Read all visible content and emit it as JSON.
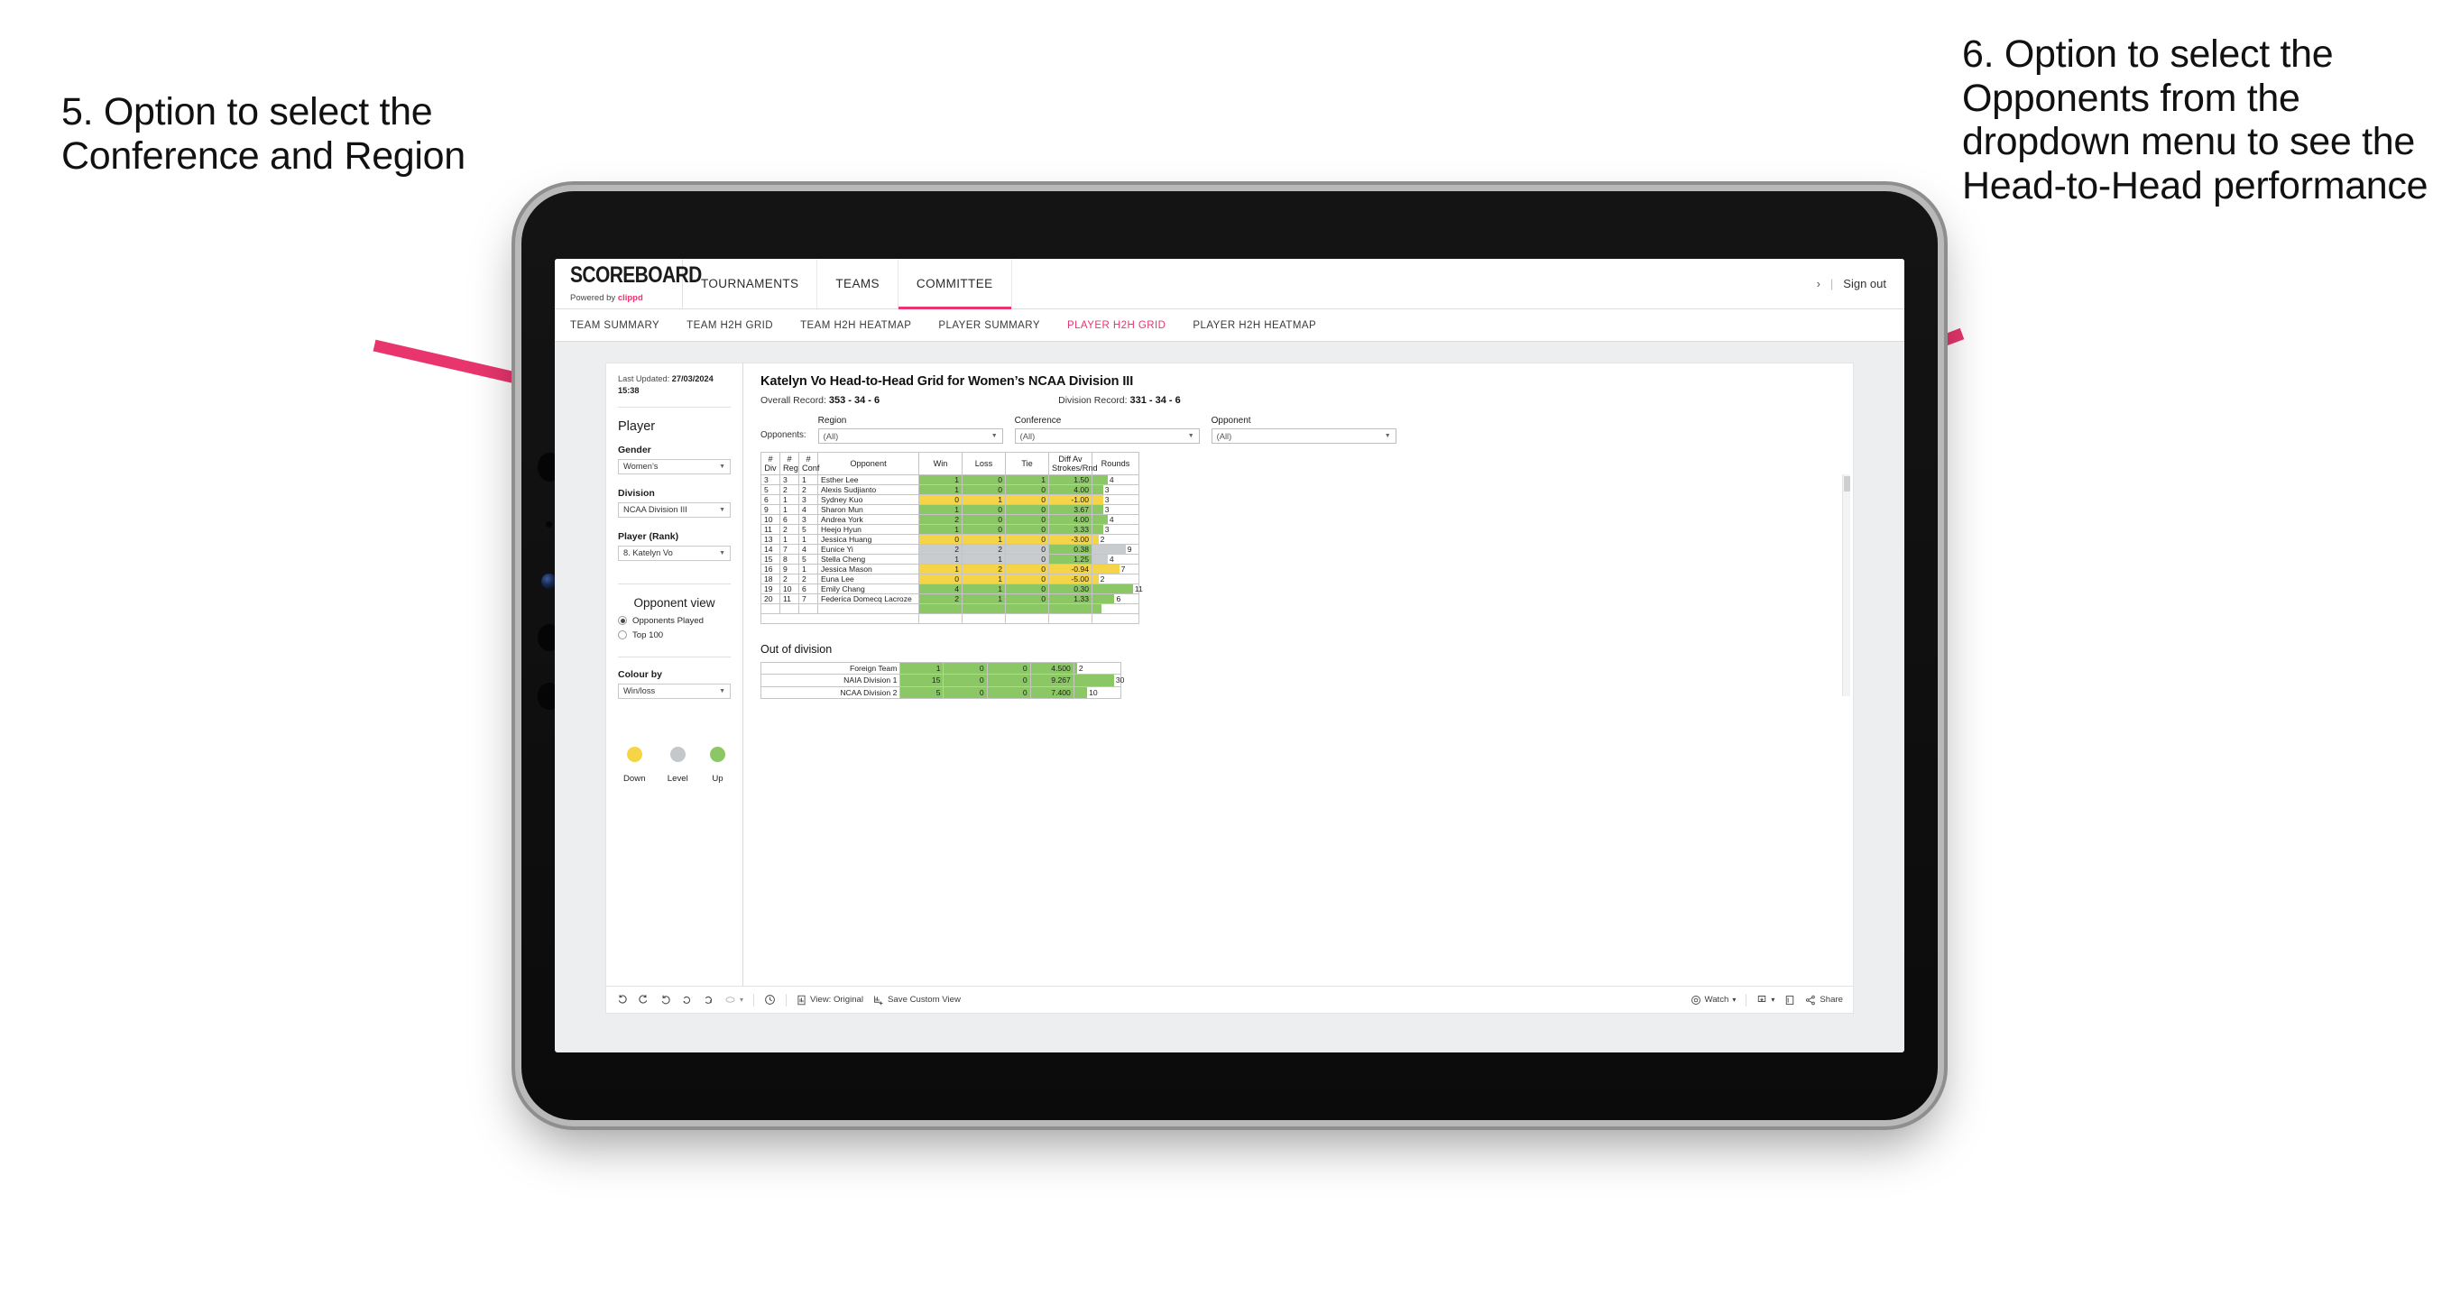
{
  "annotations": {
    "left": "5. Option to select the Conference and Region",
    "right": "6. Option to select the Opponents from the dropdown menu to see the Head-to-Head performance",
    "arrow_color": "#e8356d"
  },
  "header": {
    "logo_word": "SCOREBOARD",
    "logo_powered_prefix": "Powered by ",
    "logo_brand": "clippd",
    "nav": [
      {
        "label": "TOURNAMENTS",
        "active": false
      },
      {
        "label": "TEAMS",
        "active": false
      },
      {
        "label": "COMMITTEE",
        "active": true
      }
    ],
    "chevron": "›",
    "separator": "|",
    "sign_out": "Sign out"
  },
  "subnav": [
    {
      "label": "TEAM SUMMARY",
      "active": false
    },
    {
      "label": "TEAM H2H GRID",
      "active": false
    },
    {
      "label": "TEAM H2H HEATMAP",
      "active": false
    },
    {
      "label": "PLAYER SUMMARY",
      "active": false
    },
    {
      "label": "PLAYER H2H GRID",
      "active": true
    },
    {
      "label": "PLAYER H2H HEATMAP",
      "active": false
    }
  ],
  "sidebar": {
    "last_updated_label": "Last Updated: ",
    "last_updated_value": "27/03/2024",
    "last_updated_time": "15:38",
    "player_heading": "Player",
    "gender_label": "Gender",
    "gender_value": "Women’s",
    "division_label": "Division",
    "division_value": "NCAA Division III",
    "player_rank_label": "Player (Rank)",
    "player_rank_value": "8. Katelyn Vo",
    "opponent_view_heading": "Opponent view",
    "opponent_view_options": [
      {
        "label": "Opponents Played",
        "selected": true
      },
      {
        "label": "Top 100",
        "selected": false
      }
    ],
    "colour_by_label": "Colour by",
    "colour_by_value": "Win/loss",
    "legend": [
      {
        "label": "Down",
        "color": "#f5d547"
      },
      {
        "label": "Level",
        "color": "#c4c8cc"
      },
      {
        "label": "Up",
        "color": "#8cc765"
      }
    ]
  },
  "main": {
    "title": "Katelyn Vo Head-to-Head Grid for Women’s NCAA Division III",
    "overall_record_label": "Overall Record: ",
    "overall_record_value": "353 - 34 - 6",
    "division_record_label": "Division Record: ",
    "division_record_value": "331 -  34 - 6",
    "opponents_label": "Opponents:",
    "filters": [
      {
        "caption": "Region",
        "value": "(All)"
      },
      {
        "caption": "Conference",
        "value": "(All)"
      },
      {
        "caption": "Opponent",
        "value": "(All)"
      }
    ]
  },
  "table": {
    "headers": {
      "div": [
        "#",
        "Div"
      ],
      "reg": [
        "#",
        "Reg"
      ],
      "conf": [
        "#",
        "Conf"
      ],
      "opponent": "Opponent",
      "win": "Win",
      "loss": "Loss",
      "tie": "Tie",
      "diff": [
        "Diff Av",
        "Strokes/Rnd"
      ],
      "rounds": "Rounds"
    },
    "rows": [
      {
        "div": "3",
        "reg": "3",
        "conf": "1",
        "opponent": "Esther Lee",
        "win": "1",
        "loss": "0",
        "tie": "1",
        "diff": "1.50",
        "rounds": "4",
        "color": "#8cc765",
        "bar_pct": 33
      },
      {
        "div": "5",
        "reg": "2",
        "conf": "2",
        "opponent": "Alexis Sudjianto",
        "win": "1",
        "loss": "0",
        "tie": "0",
        "diff": "4.00",
        "rounds": "3",
        "color": "#8cc765",
        "bar_pct": 23
      },
      {
        "div": "6",
        "reg": "1",
        "conf": "3",
        "opponent": "Sydney Kuo",
        "win": "0",
        "loss": "1",
        "tie": "0",
        "diff": "-1.00",
        "rounds": "3",
        "color": "#f5d547",
        "bar_pct": 23
      },
      {
        "div": "9",
        "reg": "1",
        "conf": "4",
        "opponent": "Sharon Mun",
        "win": "1",
        "loss": "0",
        "tie": "0",
        "diff": "3.67",
        "rounds": "3",
        "color": "#8cc765",
        "bar_pct": 23
      },
      {
        "div": "10",
        "reg": "6",
        "conf": "3",
        "opponent": "Andrea York",
        "win": "2",
        "loss": "0",
        "tie": "0",
        "diff": "4.00",
        "rounds": "4",
        "color": "#8cc765",
        "bar_pct": 33
      },
      {
        "div": "11",
        "reg": "2",
        "conf": "5",
        "opponent": "Heejo Hyun",
        "win": "1",
        "loss": "0",
        "tie": "0",
        "diff": "3.33",
        "rounds": "3",
        "color": "#8cc765",
        "bar_pct": 23
      },
      {
        "div": "13",
        "reg": "1",
        "conf": "1",
        "opponent": "Jessica Huang",
        "win": "0",
        "loss": "1",
        "tie": "0",
        "diff": "-3.00",
        "rounds": "2",
        "color": "#f5d547",
        "bar_pct": 13
      },
      {
        "div": "14",
        "reg": "7",
        "conf": "4",
        "opponent": "Eunice Yi",
        "win": "2",
        "loss": "2",
        "tie": "0",
        "diff": "0.38",
        "rounds": "9",
        "color": "#c9cccf",
        "diff_color": "#8cc765",
        "bar_pct": 72
      },
      {
        "div": "15",
        "reg": "8",
        "conf": "5",
        "opponent": "Stella Cheng",
        "win": "1",
        "loss": "1",
        "tie": "0",
        "diff": "1.25",
        "rounds": "4",
        "color": "#c9cccf",
        "diff_color": "#8cc765",
        "bar_pct": 33
      },
      {
        "div": "16",
        "reg": "9",
        "conf": "1",
        "opponent": "Jessica Mason",
        "win": "1",
        "loss": "2",
        "tie": "0",
        "diff": "-0.94",
        "rounds": "7",
        "color": "#f5d547",
        "bar_pct": 58
      },
      {
        "div": "18",
        "reg": "2",
        "conf": "2",
        "opponent": "Euna Lee",
        "win": "0",
        "loss": "1",
        "tie": "0",
        "diff": "-5.00",
        "rounds": "2",
        "color": "#f5d547",
        "bar_pct": 13
      },
      {
        "div": "19",
        "reg": "10",
        "conf": "6",
        "opponent": "Emily Chang",
        "win": "4",
        "loss": "1",
        "tie": "0",
        "diff": "0.30",
        "rounds": "11",
        "color": "#8cc765",
        "bar_pct": 88
      },
      {
        "div": "20",
        "reg": "11",
        "conf": "7",
        "opponent": "Federica Domecq Lacroze",
        "win": "2",
        "loss": "1",
        "tie": "0",
        "diff": "1.33",
        "rounds": "6",
        "color": "#8cc765",
        "bar_pct": 48
      }
    ]
  },
  "out_of_division": {
    "title": "Out of division",
    "rows": [
      {
        "name": "Foreign Team",
        "win": "1",
        "loss": "0",
        "tie": "0",
        "diff": "4.500",
        "rounds": "2",
        "color": "#8cc765",
        "bar_pct": 6
      },
      {
        "name": "NAIA Division 1",
        "win": "15",
        "loss": "0",
        "tie": "0",
        "diff": "9.267",
        "rounds": "30",
        "color": "#8cc765",
        "bar_pct": 86
      },
      {
        "name": "NCAA Division 2",
        "win": "5",
        "loss": "0",
        "tie": "0",
        "diff": "7.400",
        "rounds": "10",
        "color": "#8cc765",
        "bar_pct": 28
      }
    ]
  },
  "toolbar": {
    "view_label": "View: Original",
    "save_custom_view": "Save Custom View",
    "watch": "Watch",
    "share": "Share",
    "caret": "▾"
  }
}
